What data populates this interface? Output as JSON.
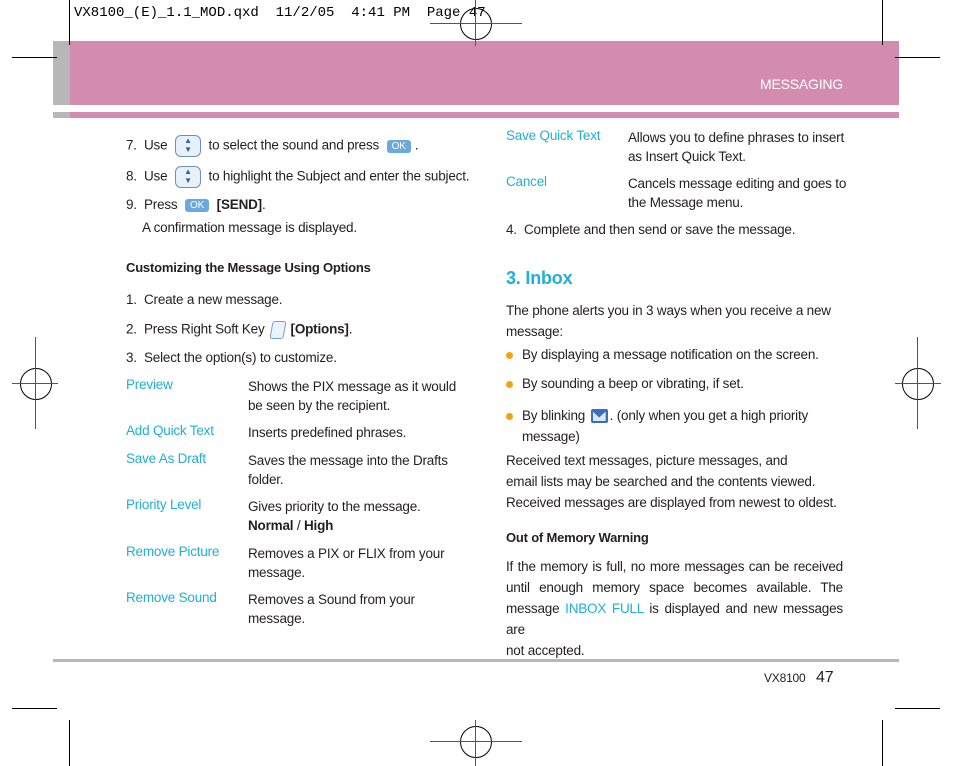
{
  "slug": "VX8100_(E)_1.1_MOD.qxd  11/2/05  4:41 PM  Page 47",
  "header": {
    "section": "MESSAGING"
  },
  "left": {
    "steps_top": [
      {
        "num": "7.",
        "pre": "Use",
        "icon": "nav-key-icon",
        "post": "to select the sound and press",
        "icon2": "ok-key-icon",
        "ok": "OK",
        "end": "."
      },
      {
        "num": "8.",
        "pre": "Use",
        "icon": "nav-key-icon",
        "post": "to highlight the Subject and enter the subject."
      },
      {
        "num": "9.",
        "pre": "Press",
        "ok": "OK",
        "bold": "[SEND]",
        "end": ".",
        "note": "A confirmation message is displayed."
      }
    ],
    "heading": "Customizing the Message Using Options",
    "steps": [
      {
        "num": "1.",
        "text": "Create a new message."
      },
      {
        "num": "2.",
        "text": "Press Right Soft Key",
        "bold": "[Options]",
        "end": "."
      },
      {
        "num": "3.",
        "text": "Select the option(s) to customize."
      }
    ],
    "options": [
      {
        "term": "Preview",
        "desc": [
          "Shows the PIX message as it would",
          "be seen by the recipient."
        ]
      },
      {
        "term": "Add Quick Text",
        "desc": [
          "Inserts predefined phrases."
        ]
      },
      {
        "term": "Save As Draft",
        "desc": [
          "Saves the message into the Drafts",
          "folder."
        ]
      },
      {
        "term": "Priority Level",
        "desc": [
          "Gives priority to the message."
        ],
        "bold_line": [
          "Normal",
          " / ",
          "High"
        ]
      },
      {
        "term": "Remove Picture",
        "desc": [
          "Removes a PIX or FLIX from your",
          "message."
        ]
      },
      {
        "term": "Remove Sound",
        "desc": [
          "Removes a Sound from your",
          "message."
        ]
      }
    ]
  },
  "right": {
    "options": [
      {
        "term": "Save Quick Text",
        "desc": [
          "Allows you to define phrases to insert",
          "as Insert Quick Text."
        ]
      },
      {
        "term": "Cancel",
        "desc": [
          "Cancels message editing and goes to",
          "the Message menu."
        ]
      }
    ],
    "step4": {
      "num": "4.",
      "text": "Complete and then send or save the message."
    },
    "inbox_title": "3. Inbox",
    "intro": [
      "The phone alerts you in 3 ways when you receive a new",
      "message:"
    ],
    "bullets": [
      "By displaying a message notification on the screen.",
      "By sounding a beep or vibrating, if set."
    ],
    "bullet3": {
      "pre": "By blinking",
      "post": ". (only when you get a high priority",
      "cont": "message)"
    },
    "para": [
      "Received text messages, picture messages, and",
      "email lists may be searched and the contents viewed.",
      "Received messages are displayed from newest to oldest."
    ],
    "oom_heading": "Out of Memory Warning",
    "oom": [
      "If the memory is full, no more messages can be received",
      "until enough memory space becomes available. The"
    ],
    "oom3": {
      "pre": "message",
      "hl": "INBOX FULL",
      "post": "is displayed and new messages are"
    },
    "oom4": "not accepted."
  },
  "footer": {
    "model": "VX8100",
    "page": "47"
  },
  "colors": {
    "band": "#d48bb0",
    "accent": "#1fb0d4",
    "bullet": "#f3a20f"
  }
}
